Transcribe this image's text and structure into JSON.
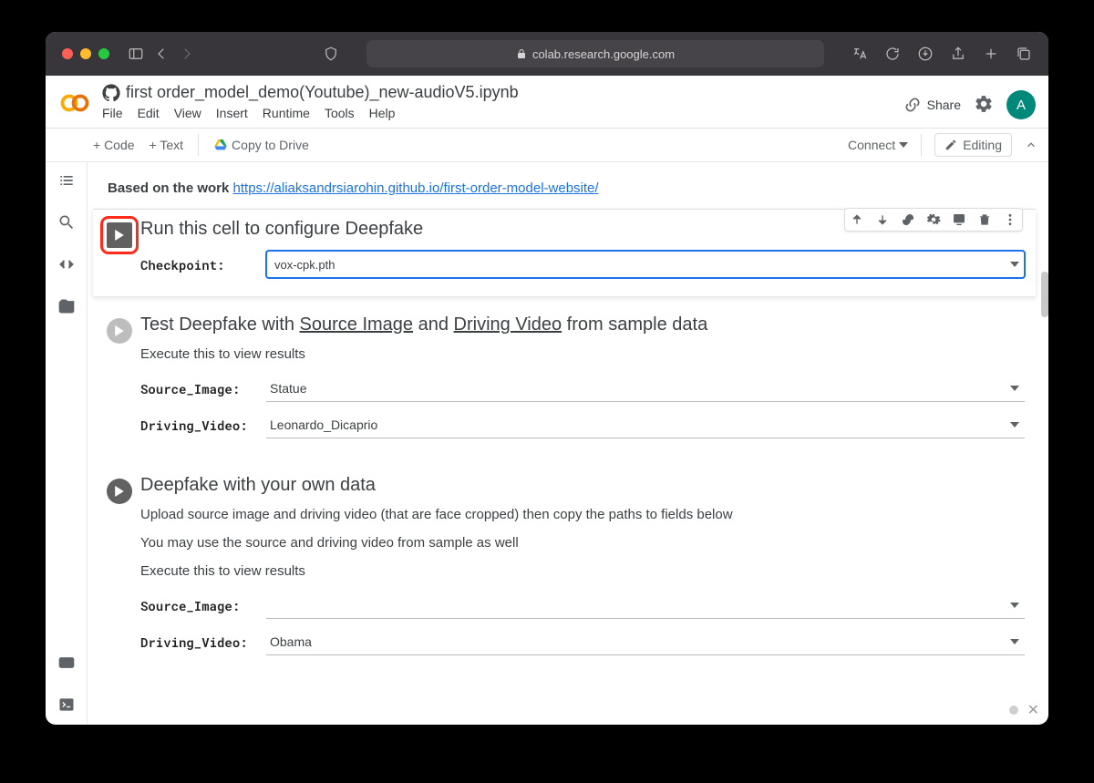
{
  "browser": {
    "url": "colab.research.google.com"
  },
  "header": {
    "doc_title": "first order_model_demo(Youtube)_new-audioV5.ipynb",
    "menus": [
      "File",
      "Edit",
      "View",
      "Insert",
      "Runtime",
      "Tools",
      "Help"
    ],
    "share_label": "Share",
    "avatar_letter": "A"
  },
  "toolbar": {
    "code_btn": "+ Code",
    "text_btn": "+ Text",
    "copy_btn": "Copy to Drive",
    "connect_label": "Connect",
    "editing_label": "Editing"
  },
  "intro": {
    "prefix": "Based on the work ",
    "link_text": "https://aliaksandrsiarohin.github.io/first-order-model-website/"
  },
  "cells": [
    {
      "title_plain": "Run this cell to configure Deepfake",
      "selected": true,
      "highlighted_run": true,
      "form": [
        {
          "label": "Checkpoint:",
          "value": "vox-cpk.pth",
          "style": "box",
          "focused": true
        }
      ]
    },
    {
      "title_prefix": "Test Deepfake with ",
      "title_link1": "Source Image",
      "title_mid": " and ",
      "title_link2": "Driving Video",
      "title_suffix": " from sample data",
      "desc": [
        "Execute this to view results"
      ],
      "run_light": true,
      "form": [
        {
          "label": "Source_Image:",
          "value": "Statue",
          "style": "underline"
        },
        {
          "label": "Driving_Video:",
          "value": "Leonardo_Dicaprio",
          "style": "underline"
        }
      ]
    },
    {
      "title_plain": "Deepfake with your own data",
      "desc": [
        "Upload source image and driving video (that are face cropped) then copy the paths to fields below",
        "You may use the source and driving video from sample as well",
        "Execute this to view results"
      ],
      "form": [
        {
          "label": "Source_Image:",
          "value": "",
          "style": "underline"
        },
        {
          "label": "Driving_Video:",
          "value": "Obama",
          "style": "underline"
        }
      ]
    }
  ]
}
